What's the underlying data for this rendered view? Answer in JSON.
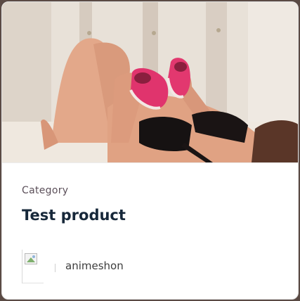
{
  "product": {
    "image_alt": "product thumbnail",
    "category": "Category",
    "title": "Test product"
  },
  "author": {
    "avatar_alt": "author avatar (broken image)",
    "name": "animeshon"
  },
  "colors": {
    "card_bg": "#ffffff",
    "title": "#17283a",
    "category": "#5b4f59",
    "author": "#3d3d3d",
    "shoe_pink": "#e0346d"
  }
}
